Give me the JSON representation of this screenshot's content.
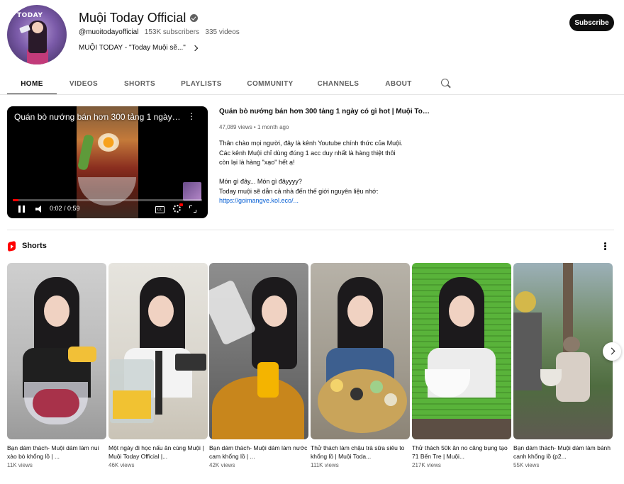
{
  "channel": {
    "name": "Muội Today Official",
    "handle": "@muoitodayofficial",
    "subscribers": "153K subscribers",
    "videos": "335 videos",
    "description": "MUỘI TODAY - \"Today Muội sẽ...\"",
    "avatar_text": "TODAY",
    "subscribe_label": "Subscribe"
  },
  "tabs": [
    {
      "label": "HOME",
      "active": true
    },
    {
      "label": "VIDEOS",
      "active": false
    },
    {
      "label": "SHORTS",
      "active": false
    },
    {
      "label": "PLAYLISTS",
      "active": false
    },
    {
      "label": "COMMUNITY",
      "active": false
    },
    {
      "label": "CHANNELS",
      "active": false
    },
    {
      "label": "ABOUT",
      "active": false
    }
  ],
  "featured": {
    "overlay_title": "Quán bò nướng bán hơn 300 tảng 1 ngày ...",
    "title": "Quán bò nướng bán hơn 300 tảng 1 ngày có gì hot | Muội Toda...",
    "views": "47,089 views",
    "age": "1 month ago",
    "time": "0:02 / 0:59",
    "progress": 0.03,
    "cc_label": "CC",
    "desc_lines": [
      "Thân chào mọi người, đây là kênh Youtube chính thức của Muội.",
      "Các kênh Muội chỉ dùng đúng 1 acc duy nhất là hàng thiệt thôi",
      "còn lại là hàng \"xạo\" hết ạ!",
      "",
      "Món gì đây... Món gì đâyyyy?",
      "Today muội sẽ dẫn cả nhà đến thế giới nguyên liệu nhớ:"
    ],
    "link": "https://goimangve.kol.eco/..."
  },
  "shorts_section": {
    "title": "Shorts",
    "items": [
      {
        "title": "Bạn dám thách- Muội dám làm nui xào bò khổng lồ | ...",
        "views": "11K views"
      },
      {
        "title": "Một ngày đi học nấu ăn cùng Muội | Muội Today Official |...",
        "views": "46K views"
      },
      {
        "title": "Bạn dám thách- Muội dám làm nước cam khổng lồ | ...",
        "views": "42K views"
      },
      {
        "title": "Thử thách làm chậu trà sữa siêu to khổng lồ | Muội Toda...",
        "views": "111K views"
      },
      {
        "title": "Thử thách 50k ăn no căng bụng tạo 71 Bến Tre | Muội...",
        "views": "217K views"
      },
      {
        "title": "Bạn dám thách- Muội dám làm bánh canh khổng lồ (p2...",
        "views": "55K views"
      }
    ]
  },
  "colors": {
    "accent_red": "#ff0000",
    "link_blue": "#065fd4",
    "text_primary": "#0f0f0f",
    "text_secondary": "#606060"
  },
  "icons": [
    "verified-icon",
    "chevron-right-icon",
    "search-icon",
    "pause-icon",
    "volume-icon",
    "cc-icon",
    "gear-icon",
    "fullscreen-icon",
    "shorts-icon",
    "more-vert-icon",
    "next-arrow-icon"
  ]
}
